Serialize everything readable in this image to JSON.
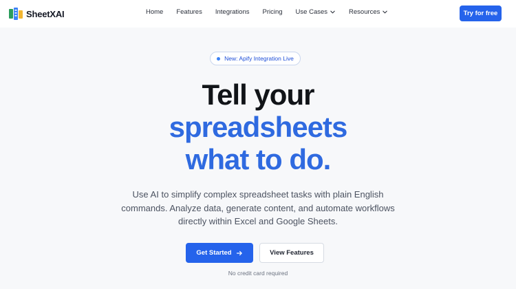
{
  "nav": {
    "brand": "SheetXAI",
    "links": [
      {
        "label": "Home",
        "icon": null
      },
      {
        "label": "Features",
        "icon": null
      },
      {
        "label": "Integrations",
        "icon": null
      },
      {
        "label": "Pricing",
        "icon": null
      },
      {
        "label": "Use Cases",
        "icon": "chevron-down-icon"
      },
      {
        "label": "Resources",
        "icon": "chevron-down-icon"
      }
    ],
    "cta_label": "Try for free"
  },
  "hero": {
    "badge_text": "New: Apify Integration Live",
    "headline_line1": "Tell your",
    "headline_line2": "spreadsheets",
    "headline_line3": "what to do.",
    "subtext": "Use AI to simplify complex spreadsheet tasks with plain English commands. Analyze data, generate content, and automate workflows directly within Excel and Google Sheets.",
    "primary_button": "Get Started",
    "secondary_button": "View Features",
    "note": "No credit card required"
  },
  "colors": {
    "accent": "#2563eb",
    "headline_dark": "#111418",
    "headline_blue": "#2f6ae0",
    "background": "#f7f8fa"
  }
}
